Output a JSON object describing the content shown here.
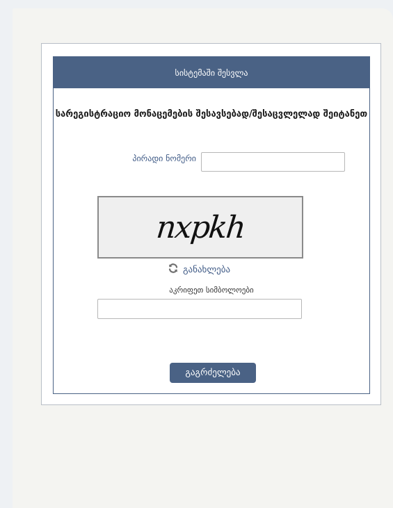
{
  "form": {
    "header_title": "სისტემაში შესვლა",
    "instruction": "სარეგისტრაციო მონაცემების შესავსებად/შესაცვლელად შეიტანეთ",
    "personal_id": {
      "label": "პირადი ნომერი",
      "value": "",
      "placeholder": ""
    },
    "captcha": {
      "text": "nxpkh",
      "refresh_label": "განახლება",
      "refresh_icon": "refresh-icon"
    },
    "symbols": {
      "label": "აკრიფეთ სიმბოლოები",
      "value": "",
      "placeholder": ""
    },
    "continue_label": "გაგრძელება"
  },
  "colors": {
    "accent": "#4a6285",
    "link": "#3f5a86",
    "background": "#eef1f4"
  }
}
